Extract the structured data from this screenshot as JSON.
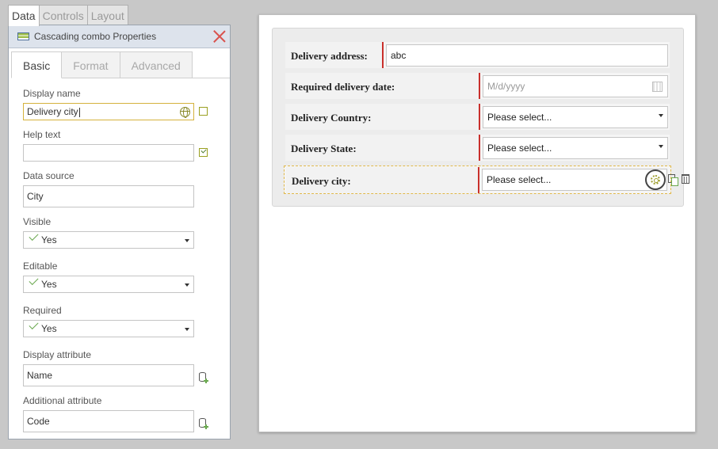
{
  "top_tabs": [
    {
      "label": "Data",
      "active": true
    },
    {
      "label": "Controls",
      "active": false
    },
    {
      "label": "Layout",
      "active": false
    }
  ],
  "panel": {
    "title": "Cascading combo Properties",
    "sub_tabs": [
      {
        "label": "Basic",
        "active": true
      },
      {
        "label": "Format",
        "active": false
      },
      {
        "label": "Advanced",
        "active": false
      }
    ],
    "display_name": {
      "label": "Display name",
      "value": "Delivery city"
    },
    "help_text": {
      "label": "Help text",
      "value": ""
    },
    "data_source": {
      "label": "Data source",
      "value": "City"
    },
    "visible": {
      "label": "Visible",
      "value": "Yes"
    },
    "editable": {
      "label": "Editable",
      "value": "Yes"
    },
    "required": {
      "label": "Required",
      "value": "Yes"
    },
    "display_attribute": {
      "label": "Display attribute",
      "value": "Name"
    },
    "additional_attribute": {
      "label": "Additional attribute",
      "value": "Code"
    }
  },
  "form": {
    "rows": [
      {
        "label": "Delivery address:",
        "value": "abc",
        "placeholder": false
      },
      {
        "label": "Required delivery date:",
        "value": "M/d/yyyy",
        "placeholder": true
      },
      {
        "label": "Delivery Country:",
        "value": "Please select...",
        "placeholder": false
      },
      {
        "label": "Delivery State:",
        "value": "Please select...",
        "placeholder": false
      },
      {
        "label": "Delivery city:",
        "value": "Please select...",
        "placeholder": false
      }
    ]
  },
  "colors": {
    "required_marker": "#c9302c",
    "focus_border": "#d5b23c",
    "check_green": "#6aa84f"
  }
}
